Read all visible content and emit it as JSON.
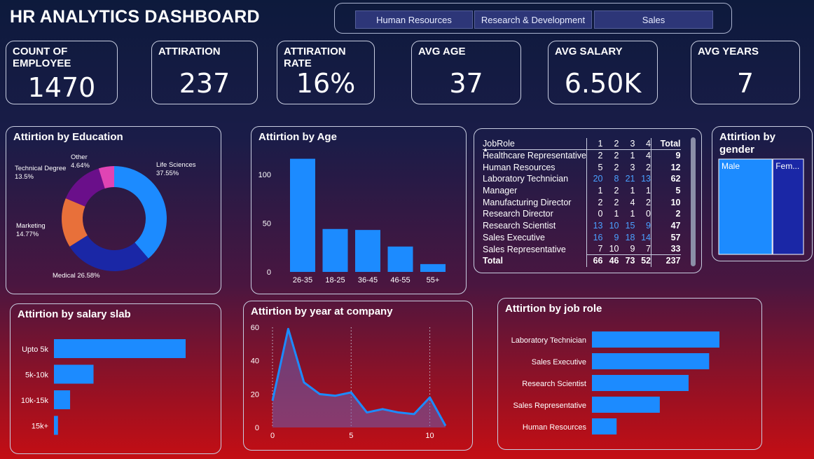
{
  "title": "HR ANALYTICS DASHBOARD",
  "slicers": [
    "Human Resources",
    "Research & Development",
    "Sales"
  ],
  "kpis": [
    {
      "label": "COUNT OF EMPLOYEE",
      "value": "1470"
    },
    {
      "label": "ATTIRATION",
      "value": "237"
    },
    {
      "label": "ATTIRATION RATE",
      "value": "16%"
    },
    {
      "label": "AVG AGE",
      "value": "37"
    },
    {
      "label": "AVG SALARY",
      "value": "6.50K"
    },
    {
      "label": "AVG YEARS",
      "value": "7"
    }
  ],
  "titles": {
    "education": "Attirtion by Education",
    "age": "Attirtion by Age",
    "gender": "Attirtion by gender",
    "salary": "Attirtion by salary slab",
    "years": "Attirtion by year at company",
    "jobrole": "Attirtion by job role"
  },
  "matrix": {
    "header": [
      "JobRole",
      "1",
      "2",
      "3",
      "4",
      "Total"
    ],
    "rows": [
      {
        "role": "Healthcare Representative",
        "v": [
          2,
          2,
          1,
          4
        ],
        "total": 9
      },
      {
        "role": "Human Resources",
        "v": [
          5,
          2,
          3,
          2
        ],
        "total": 12
      },
      {
        "role": "Laboratory Technician",
        "v": [
          20,
          8,
          21,
          13
        ],
        "total": 62
      },
      {
        "role": "Manager",
        "v": [
          1,
          2,
          1,
          1
        ],
        "total": 5
      },
      {
        "role": "Manufacturing Director",
        "v": [
          2,
          2,
          4,
          2
        ],
        "total": 10
      },
      {
        "role": "Research Director",
        "v": [
          0,
          1,
          1,
          0
        ],
        "total": 2
      },
      {
        "role": "Research Scientist",
        "v": [
          13,
          10,
          15,
          9
        ],
        "total": 47
      },
      {
        "role": "Sales Executive",
        "v": [
          16,
          9,
          18,
          14
        ],
        "total": 57
      },
      {
        "role": "Sales Representative",
        "v": [
          7,
          10,
          9,
          7
        ],
        "total": 33
      }
    ],
    "total": {
      "label": "Total",
      "v": [
        66,
        46,
        73,
        52
      ],
      "total": 237
    }
  },
  "colors": {
    "bar": "#1c8bff",
    "dark_blue": "#1a27a6",
    "orange": "#e8703a",
    "purple": "#6a0f8a",
    "pink": "#e044b4",
    "violet": "#8a4fd0"
  },
  "chart_data": [
    {
      "type": "pie",
      "title": "Attirtion by Education",
      "categories": [
        "Life Sciences",
        "Medical",
        "Marketing",
        "Technical Degree",
        "Other"
      ],
      "values": [
        37.55,
        26.58,
        14.77,
        13.5,
        4.64
      ],
      "labels": [
        "Life Sciences\n37.55%",
        "Medical 26.58%",
        "Marketing\n14.77%",
        "Technical Degree\n13.5%",
        "Other\n4.64%"
      ],
      "donut": true,
      "colors": [
        "#1c8bff",
        "#1a27a6",
        "#e8703a",
        "#6a0f8a",
        "#e044b4"
      ]
    },
    {
      "type": "bar",
      "title": "Attirtion by Age",
      "categories": [
        "26-35",
        "18-25",
        "36-45",
        "46-55",
        "55+"
      ],
      "values": [
        116,
        44,
        43,
        26,
        8
      ],
      "yticks": [
        0,
        50,
        100
      ],
      "ylim": [
        0,
        120
      ]
    },
    {
      "type": "bar",
      "title": "Attirtion by gender",
      "categories": [
        "Male",
        "Fem..."
      ],
      "values": [
        150,
        87
      ],
      "orientation": "treemap"
    },
    {
      "type": "bar",
      "orientation": "horizontal",
      "title": "Attirtion by salary slab",
      "categories": [
        "Upto 5k",
        "5k-10k",
        "10k-15k",
        "15k+"
      ],
      "values": [
        163,
        49,
        20,
        5
      ]
    },
    {
      "type": "area",
      "title": "Attirtion by year at company",
      "x": [
        0,
        1,
        2,
        3,
        4,
        5,
        6,
        7,
        8,
        9,
        10,
        11
      ],
      "values": [
        16,
        59,
        27,
        20,
        19,
        21,
        9,
        11,
        9,
        8,
        18,
        1
      ],
      "xticks": [
        0,
        5,
        10
      ],
      "yticks": [
        0,
        20,
        40,
        60
      ],
      "xlim": [
        0,
        11
      ],
      "ylim": [
        0,
        60
      ],
      "grid": "vertical dotted"
    },
    {
      "type": "bar",
      "orientation": "horizontal",
      "title": "Attirtion by job role",
      "categories": [
        "Laboratory Technician",
        "Sales Executive",
        "Research Scientist",
        "Sales Representative",
        "Human Resources"
      ],
      "values": [
        62,
        57,
        47,
        33,
        12
      ]
    }
  ]
}
